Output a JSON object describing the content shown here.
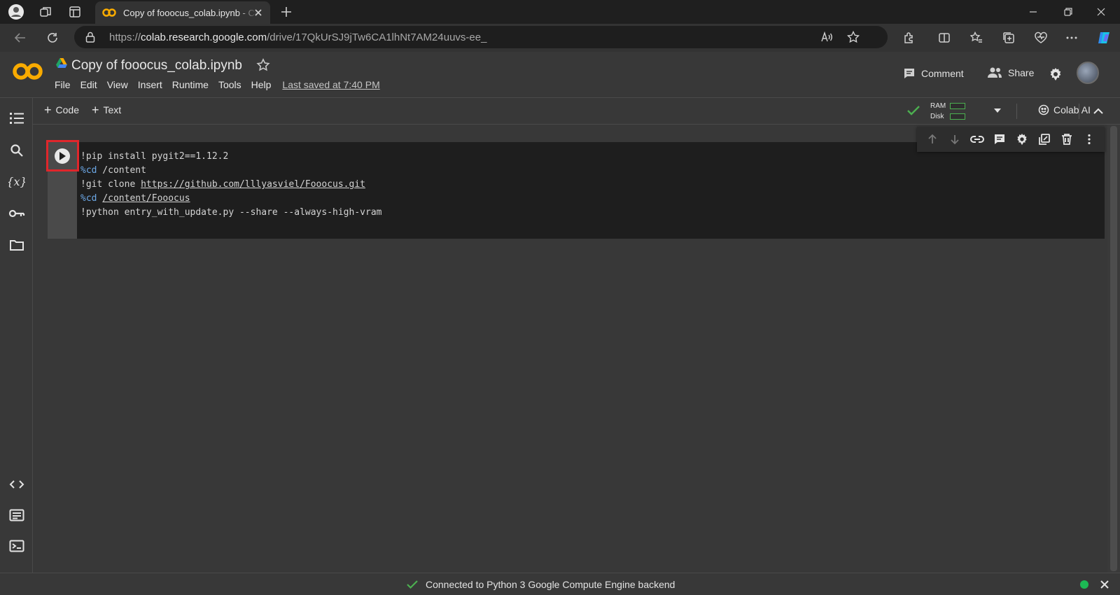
{
  "browser": {
    "tab_title": "Copy of fooocus_colab.ipynb - Colab",
    "url_scheme": "https://",
    "url_host": "colab.research.google.com",
    "url_path": "/drive/17QkUrSJ9jTw6CA1lhNt7AM24uuvs-ee_"
  },
  "notebook": {
    "title": "Copy of fooocus_colab.ipynb",
    "menu": [
      "File",
      "Edit",
      "View",
      "Insert",
      "Runtime",
      "Tools",
      "Help"
    ],
    "last_saved": "Last saved at 7:40 PM"
  },
  "header_actions": {
    "comment_label": "Comment",
    "share_label": "Share"
  },
  "toolbar": {
    "add_code_label": "Code",
    "add_text_label": "Text",
    "ram_label": "RAM",
    "disk_label": "Disk",
    "colab_ai_label": "Colab AI"
  },
  "cell": {
    "lines": [
      {
        "prefix": "!pip install pygit2==1.12.2",
        "magic": "",
        "link": ""
      },
      {
        "prefix": "",
        "magic": "%cd",
        "rest": " /content",
        "link": ""
      },
      {
        "prefix": "!git clone ",
        "magic": "",
        "link": "https://github.com/lllyasviel/Fooocus.git"
      },
      {
        "prefix": "",
        "magic": "%cd",
        "rest": " ",
        "link": "/content/Fooocus"
      },
      {
        "prefix": "!python entry_with_update.py --share --always-high-vram",
        "magic": "",
        "link": ""
      }
    ]
  },
  "status": {
    "message": "Connected to Python 3 Google Compute Engine backend"
  },
  "colors": {
    "accent_orange": "#f9ab00",
    "run_highlight": "#e0262b",
    "status_green": "#1db954"
  }
}
